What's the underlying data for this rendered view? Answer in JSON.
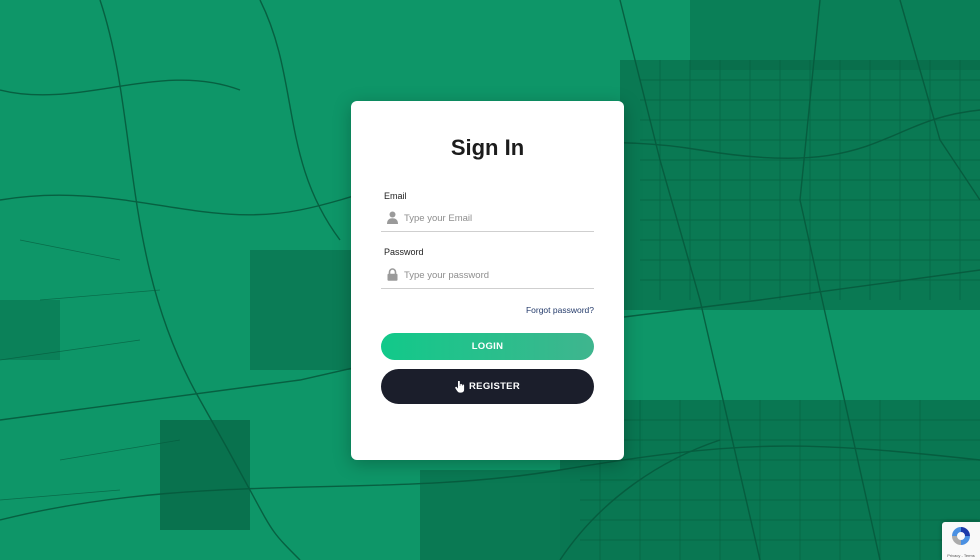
{
  "form": {
    "title": "Sign In",
    "email": {
      "label": "Email",
      "placeholder": "Type your Email",
      "icon": "user-icon"
    },
    "password": {
      "label": "Password",
      "placeholder": "Type your password",
      "icon": "lock-icon"
    },
    "forgot_label": "Forgot password?",
    "login_label": "LOGIN",
    "register_label": "REGISTER"
  },
  "recaptcha": {
    "footer": "Privacy - Terms"
  },
  "colors": {
    "background": "#0e9668",
    "map_lines": "#075a3d",
    "login_gradient_start": "#12c98a",
    "login_gradient_end": "#3fb58e",
    "register": "#1b1e2b",
    "link": "#243b6b"
  }
}
